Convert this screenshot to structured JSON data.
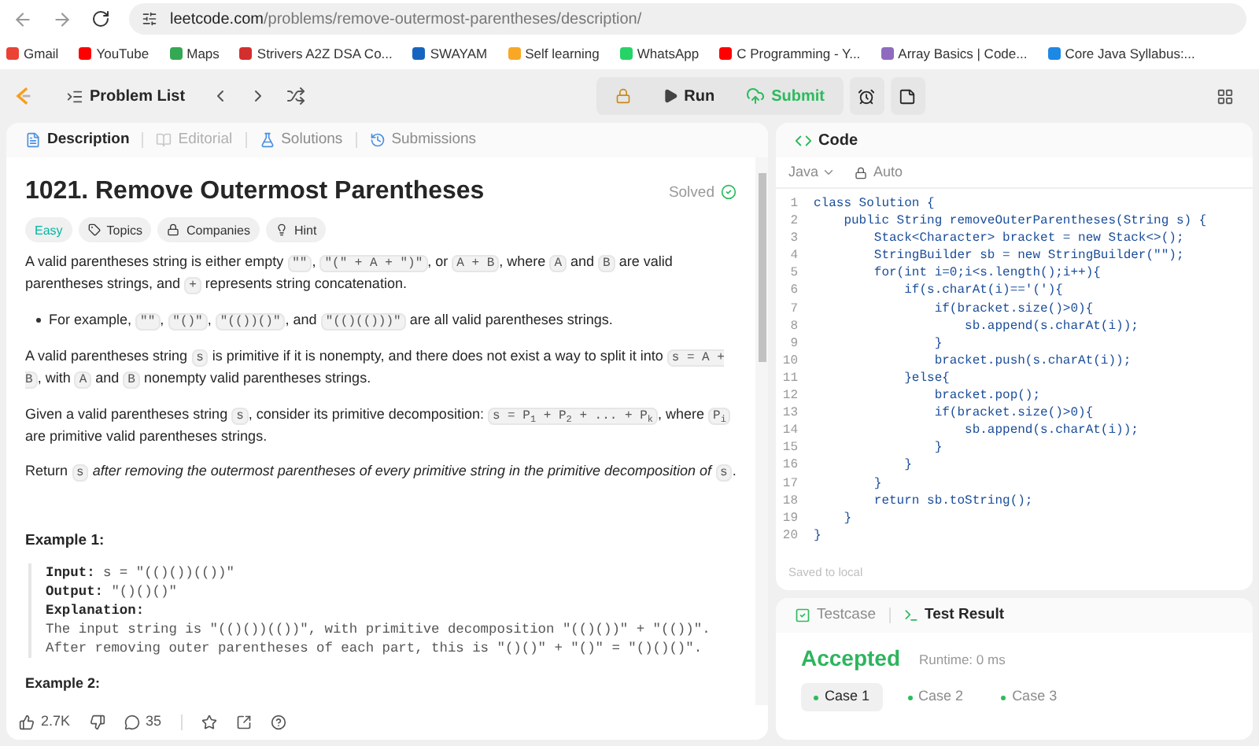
{
  "browser": {
    "url_host": "leetcode.com",
    "url_path": "/problems/remove-outermost-parentheses/description/",
    "bookmarks": [
      {
        "label": "Gmail",
        "color": "#ea4335"
      },
      {
        "label": "YouTube",
        "color": "#ff0000"
      },
      {
        "label": "Maps",
        "color": "#34a853"
      },
      {
        "label": "Strivers A2Z DSA Co...",
        "color": "#d32f2f"
      },
      {
        "label": "SWAYAM",
        "color": "#1565c0"
      },
      {
        "label": "Self learning",
        "color": "#f9a825"
      },
      {
        "label": "WhatsApp",
        "color": "#25d366"
      },
      {
        "label": "C Programming - Y...",
        "color": "#ff0000"
      },
      {
        "label": "Array Basics | Code...",
        "color": "#8e6bbf"
      },
      {
        "label": "Core Java Syllabus:...",
        "color": "#1e88e5"
      }
    ]
  },
  "toolbar": {
    "problem_list": "Problem List",
    "run": "Run",
    "submit": "Submit"
  },
  "tabs": [
    {
      "label": "Description",
      "selected": true,
      "disabled": false,
      "kind": "description"
    },
    {
      "label": "Editorial",
      "selected": false,
      "disabled": true,
      "kind": "editorial"
    },
    {
      "label": "Solutions",
      "selected": false,
      "disabled": false,
      "kind": "solutions"
    },
    {
      "label": "Submissions",
      "selected": false,
      "disabled": false,
      "kind": "submissions"
    }
  ],
  "problem": {
    "title": "1021. Remove Outermost Parentheses",
    "status": "Solved",
    "tags": [
      {
        "label": "Easy",
        "kind": "difficulty"
      },
      {
        "label": "Topics",
        "kind": "topics"
      },
      {
        "label": "Companies",
        "kind": "companies"
      },
      {
        "label": "Hint",
        "kind": "hint"
      }
    ],
    "paragraphs": [
      {
        "kind": "p",
        "segments": [
          {
            "t": "A valid parentheses string is either empty ",
            "kind": "text"
          },
          {
            "t": "\"\"",
            "kind": "code"
          },
          {
            "t": ", ",
            "kind": "text"
          },
          {
            "t": "\"(\" + A + \")\"",
            "kind": "code"
          },
          {
            "t": ", or ",
            "kind": "text"
          },
          {
            "t": "A + B",
            "kind": "code"
          },
          {
            "t": ", where ",
            "kind": "text"
          },
          {
            "t": "A",
            "kind": "code"
          },
          {
            "t": " and ",
            "kind": "text"
          },
          {
            "t": "B",
            "kind": "code"
          },
          {
            "t": " are valid parentheses strings, and ",
            "kind": "text"
          },
          {
            "t": "+",
            "kind": "code"
          },
          {
            "t": " represents string concatenation.",
            "kind": "text"
          }
        ]
      },
      {
        "kind": "bullet",
        "segments": [
          {
            "t": "For example, ",
            "kind": "text"
          },
          {
            "t": "\"\"",
            "kind": "code"
          },
          {
            "t": ", ",
            "kind": "text"
          },
          {
            "t": "\"()\"",
            "kind": "code"
          },
          {
            "t": ", ",
            "kind": "text"
          },
          {
            "t": "\"(())()\"",
            "kind": "code"
          },
          {
            "t": ", and ",
            "kind": "text"
          },
          {
            "t": "\"(()(()))\"",
            "kind": "code"
          },
          {
            "t": " are all valid parentheses strings.",
            "kind": "text"
          }
        ]
      },
      {
        "kind": "p",
        "segments": [
          {
            "t": "A valid parentheses string ",
            "kind": "text"
          },
          {
            "t": "s",
            "kind": "code"
          },
          {
            "t": " is primitive if it is nonempty, and there does not exist a way to split it into ",
            "kind": "text"
          },
          {
            "t": "s = A + B",
            "kind": "code"
          },
          {
            "t": ", with ",
            "kind": "text"
          },
          {
            "t": "A",
            "kind": "code"
          },
          {
            "t": " and ",
            "kind": "text"
          },
          {
            "t": "B",
            "kind": "code"
          },
          {
            "t": " nonempty valid parentheses strings.",
            "kind": "text"
          }
        ]
      },
      {
        "kind": "p",
        "segments": [
          {
            "t": "Given a valid parentheses string ",
            "kind": "text"
          },
          {
            "t": "s",
            "kind": "code"
          },
          {
            "t": ", consider its primitive decomposition: ",
            "kind": "text"
          },
          {
            "t": "s = P$_{1}$ + P$_{2}$ + ... + P$_{k}$",
            "kind": "code"
          },
          {
            "t": ", where ",
            "kind": "text"
          },
          {
            "t": "P$_{i}$",
            "kind": "code"
          },
          {
            "t": " are primitive valid parentheses strings.",
            "kind": "text"
          }
        ]
      },
      {
        "kind": "p",
        "segments": [
          {
            "t": "Return ",
            "kind": "text"
          },
          {
            "t": "s",
            "kind": "code"
          },
          {
            "t": " after removing the outermost parentheses of every primitive string in the primitive decomposition of ",
            "kind": "italic"
          },
          {
            "t": "s",
            "kind": "code"
          },
          {
            "t": ".",
            "kind": "text"
          }
        ]
      }
    ],
    "example": {
      "heading": "Example 1:",
      "fields": [
        {
          "label": "Input:",
          "value": "s = \"(()())(())\""
        },
        {
          "label": "Output:",
          "value": "\"()()()\""
        }
      ],
      "explanation_label": "Explanation:",
      "explanation_lines": [
        "The input string is \"(()())(())\", with primitive decomposition \"(()())\" + \"(())\".",
        "After removing outer parentheses of each part, this is \"()()\" + \"()\" = \"()()()\"."
      ]
    },
    "next_heading": "Example 2:",
    "footer": {
      "likes": "2.7K",
      "comments": "35"
    }
  },
  "code": {
    "title": "Code",
    "language": "Java",
    "mode": "Auto",
    "saved": "Saved to local",
    "lines": [
      {
        "n": "1",
        "text": "class Solution {"
      },
      {
        "n": "2",
        "text": "    public String removeOuterParentheses(String s) {"
      },
      {
        "n": "3",
        "text": "        Stack<Character> bracket = new Stack<>();"
      },
      {
        "n": "4",
        "text": "        StringBuilder sb = new StringBuilder(\"\");"
      },
      {
        "n": "5",
        "text": "        for(int i=0;i<s.length();i++){"
      },
      {
        "n": "6",
        "text": "            if(s.charAt(i)=='('){"
      },
      {
        "n": "7",
        "text": "                if(bracket.size()>0){"
      },
      {
        "n": "8",
        "text": "                    sb.append(s.charAt(i));"
      },
      {
        "n": "9",
        "text": "                }"
      },
      {
        "n": "10",
        "text": "                bracket.push(s.charAt(i));"
      },
      {
        "n": "11",
        "text": "            }else{"
      },
      {
        "n": "12",
        "text": "                bracket.pop();"
      },
      {
        "n": "13",
        "text": "                if(bracket.size()>0){"
      },
      {
        "n": "14",
        "text": "                    sb.append(s.charAt(i));"
      },
      {
        "n": "15",
        "text": "                }"
      },
      {
        "n": "16",
        "text": "            }"
      },
      {
        "n": "17",
        "text": "        }"
      },
      {
        "n": "18",
        "text": "        return sb.toString();"
      },
      {
        "n": "19",
        "text": "    }"
      },
      {
        "n": "20",
        "text": "}"
      }
    ]
  },
  "result": {
    "tabs": [
      {
        "label": "Testcase",
        "selected": false,
        "kind": "testcase"
      },
      {
        "label": "Test Result",
        "selected": true,
        "kind": "result"
      }
    ],
    "status": "Accepted",
    "runtime": "Runtime: 0 ms",
    "cases": [
      {
        "label": "Case 1",
        "selected": true
      },
      {
        "label": "Case 2",
        "selected": false
      },
      {
        "label": "Case 3",
        "selected": false
      }
    ]
  }
}
